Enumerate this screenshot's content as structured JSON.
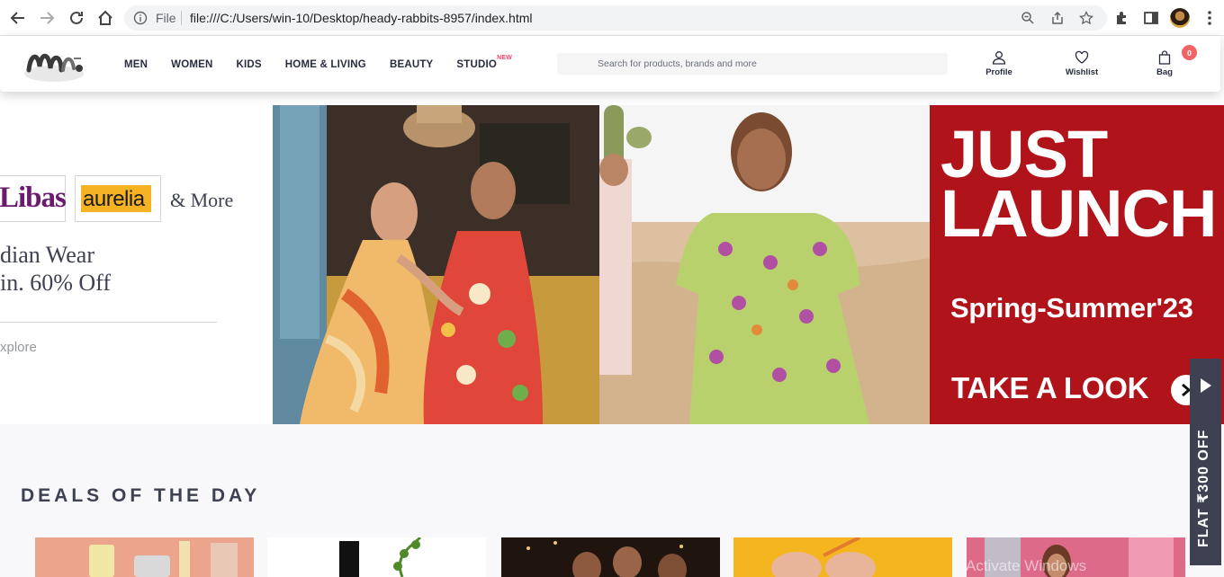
{
  "browser": {
    "address_scheme": "File",
    "url": "file:///C:/Users/win-10/Desktop/heady-rabbits-8957/index.html"
  },
  "header": {
    "nav": [
      {
        "label": "MEN"
      },
      {
        "label": "WOMEN"
      },
      {
        "label": "KIDS"
      },
      {
        "label": "HOME & LIVING"
      },
      {
        "label": "BEAUTY"
      },
      {
        "label": "STUDIO",
        "badge": "NEW"
      }
    ],
    "search_placeholder": "Search for products, brands and more",
    "actions": {
      "profile": "Profile",
      "wishlist": "Wishlist",
      "bag": "Bag"
    },
    "bag_count": "0"
  },
  "carousel": {
    "left": {
      "brand1": "Libas",
      "brand2": "aurelia",
      "more": "& More",
      "line1": "dian Wear",
      "line2": "in. 60% Off",
      "cta": "xplore"
    },
    "right": {
      "headline1": "JUST",
      "headline2": "LAUNCH",
      "season": "Spring-Summer'23",
      "cta": "TAKE A LOOK"
    },
    "active_dot": 2,
    "dot_count": 5
  },
  "deals": {
    "title": "DEALS OF THE DAY"
  },
  "offer_tab": {
    "label": "FLAT ₹300 OFF"
  },
  "watermark": "Activate Windows",
  "colors": {
    "accent": "#ff3f6c",
    "banner_red": "#b0141a",
    "bag_badge": "#f16565",
    "dark": "#3e4152"
  }
}
